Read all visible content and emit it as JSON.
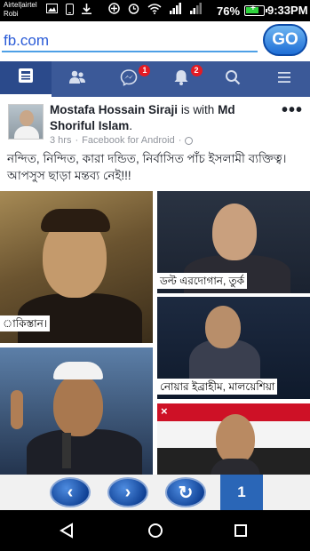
{
  "status_bar": {
    "carrier_line1": "Airtel|airtel",
    "carrier_line2": "Robi",
    "battery_percent": "76%",
    "battery_level": 0.76,
    "time": "9:33PM"
  },
  "browser": {
    "url": "fb.com",
    "go_label": "GO"
  },
  "fb_nav": {
    "items": [
      {
        "name": "news-feed",
        "icon": "news-feed-icon",
        "active": true
      },
      {
        "name": "friend-requests",
        "icon": "friends-icon"
      },
      {
        "name": "messenger",
        "icon": "messenger-icon",
        "badge": "1"
      },
      {
        "name": "notifications",
        "icon": "bell-icon",
        "badge": "2"
      },
      {
        "name": "search",
        "icon": "search-icon"
      },
      {
        "name": "menu",
        "icon": "hamburger-icon"
      }
    ],
    "accent": "#3b5998",
    "badge_color": "#e41b23"
  },
  "post": {
    "author": "Mostafa Hossain Siraji",
    "with_text": "is with",
    "tagged": "Md Shoriful Islam",
    "time": "3 hrs",
    "separator": "·",
    "source": "Facebook for Android",
    "privacy_separator": "·",
    "more": "•••",
    "text": "নন্দিত, নিন্দিত, কারা দন্ডিত, নির্বাসিত পাঁচ ইসলামী ব্যক্তিত্ব। আপসুস ছাড়া মন্তব্য নেই!!!",
    "photos": [
      {
        "caption": "াকিস্তান।"
      },
      {
        "caption": "ডল্ট এরদোগান, তুর্ক"
      },
      {
        "caption": "নোয়ার ইব্রাহীম, মালয়েশিয়া"
      },
      {
        "caption": ""
      },
      {
        "caption": ""
      }
    ]
  },
  "toolbar": {
    "back": "‹",
    "forward": "›",
    "refresh": "↻",
    "page": "1"
  }
}
